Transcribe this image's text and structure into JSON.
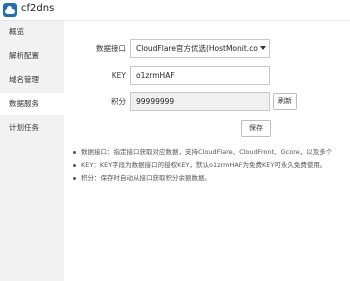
{
  "app": {
    "title": "cf2dns"
  },
  "sidebar": {
    "items": [
      {
        "label": "概览",
        "active": false
      },
      {
        "label": "解析配置",
        "active": false
      },
      {
        "label": "域名管理",
        "active": false
      },
      {
        "label": "数据服务",
        "active": true
      },
      {
        "label": "计划任务",
        "active": false
      }
    ]
  },
  "form": {
    "source_label": "数据接口",
    "source_value": "CloudFlare官方优选(HostMonit.co",
    "key_label": "KEY",
    "key_value": "o1zrmHAF",
    "points_label": "积分",
    "points_value": "99999999",
    "refresh_label": "刷新",
    "save_label": "保存"
  },
  "notes": [
    "数据接口：指定接口获取对应数据，支持CloudFlare、CloudFront、Gcore，以及多个",
    "KEY：KEY字段为数据接口的授权KEY，默认o1zrmHAF为免费KEY可永久免费使用。",
    "积分：保存时自动从接口获取积分余额数据。"
  ]
}
